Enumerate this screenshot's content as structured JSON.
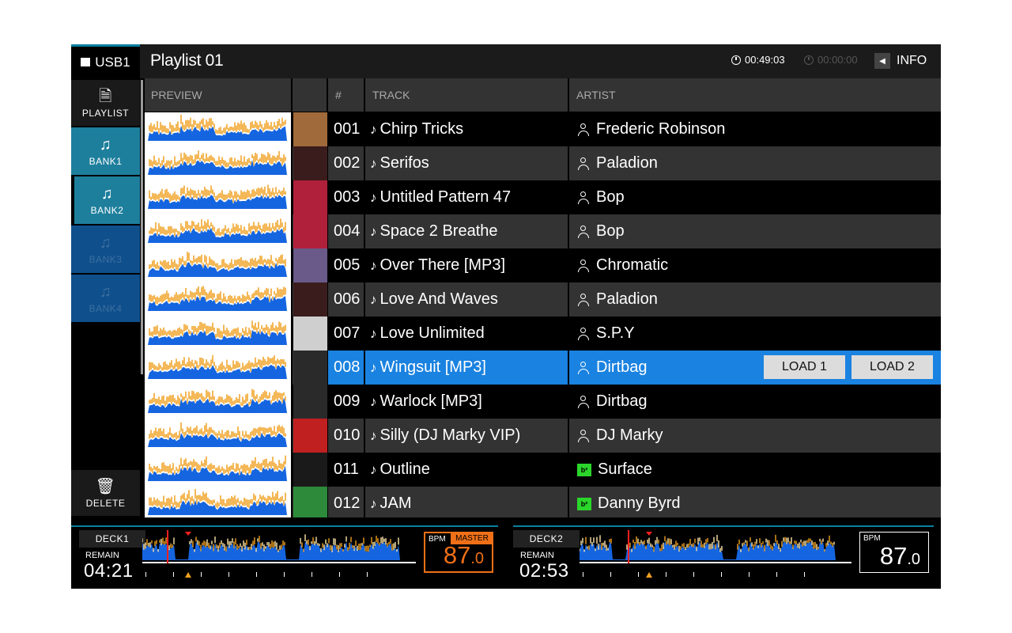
{
  "topbar": {
    "source": "USB1",
    "title": "Playlist 01",
    "elapsed": "00:49:03",
    "remain_timer": "00:00:00",
    "info_label": "INFO"
  },
  "sidebar": {
    "playlist": "PLAYLIST",
    "banks": [
      "BANK1",
      "BANK2",
      "BANK3",
      "BANK4"
    ],
    "delete": "DELETE"
  },
  "columns": {
    "preview": "PREVIEW",
    "num": "#",
    "track": "TRACK",
    "artist": "ARTIST"
  },
  "tracks": [
    {
      "num": "001",
      "title": "Chirp Tricks",
      "artist": "Frederic Robinson",
      "art": "#a06a3a",
      "icon": "person"
    },
    {
      "num": "002",
      "title": "Serifos",
      "artist": "Paladion",
      "art": "#3a1c1c",
      "icon": "person"
    },
    {
      "num": "003",
      "title": "Untitled Pattern 47",
      "artist": "Bop",
      "art": "#b0203a",
      "icon": "person"
    },
    {
      "num": "004",
      "title": "Space 2 Breathe",
      "artist": "Bop",
      "art": "#b0203a",
      "icon": "person"
    },
    {
      "num": "005",
      "title": "Over There [MP3]",
      "artist": "Chromatic",
      "art": "#6a5a8a",
      "icon": "person"
    },
    {
      "num": "006",
      "title": "Love And Waves",
      "artist": "Paladion",
      "art": "#3a1c1c",
      "icon": "person"
    },
    {
      "num": "007",
      "title": "Love Unlimited",
      "artist": "S.P.Y",
      "art": "#cfcfcf",
      "icon": "person"
    },
    {
      "num": "008",
      "title": "Wingsuit [MP3]",
      "artist": "Dirtbag",
      "art": "#2a2a2a",
      "icon": "person"
    },
    {
      "num": "009",
      "title": "Warlock [MP3]",
      "artist": "Dirtbag",
      "art": "#2a2a2a",
      "icon": "person"
    },
    {
      "num": "010",
      "title": "Silly (DJ Marky VIP)",
      "artist": "DJ Marky",
      "art": "#c02020",
      "icon": "person"
    },
    {
      "num": "011",
      "title": "Outline",
      "artist": "Surface",
      "art": "#1a1a1a",
      "icon": "label"
    },
    {
      "num": "012",
      "title": "JAM",
      "artist": "Danny Byrd",
      "art": "#2d8a3a",
      "icon": "label"
    }
  ],
  "selected_row": 7,
  "load_buttons": [
    "LOAD 1",
    "LOAD 2"
  ],
  "label_icon_text": "b²",
  "decks": [
    {
      "tag": "DECK1",
      "remain_label": "REMAIN",
      "remain": "04:21",
      "bpm_label": "BPM",
      "master": "MASTER",
      "bpm_int": "87",
      "bpm_dec": ".0",
      "accent": "#f07018"
    },
    {
      "tag": "DECK2",
      "remain_label": "REMAIN",
      "remain": "02:53",
      "bpm_label": "BPM",
      "master": "",
      "bpm_int": "87",
      "bpm_dec": ".0",
      "accent": "#ffffff"
    }
  ],
  "colors": {
    "accent": "#1a82e0",
    "bank": "#1e7f9c",
    "wave_blue": "#1565e0",
    "wave_orange": "#f0a020"
  }
}
